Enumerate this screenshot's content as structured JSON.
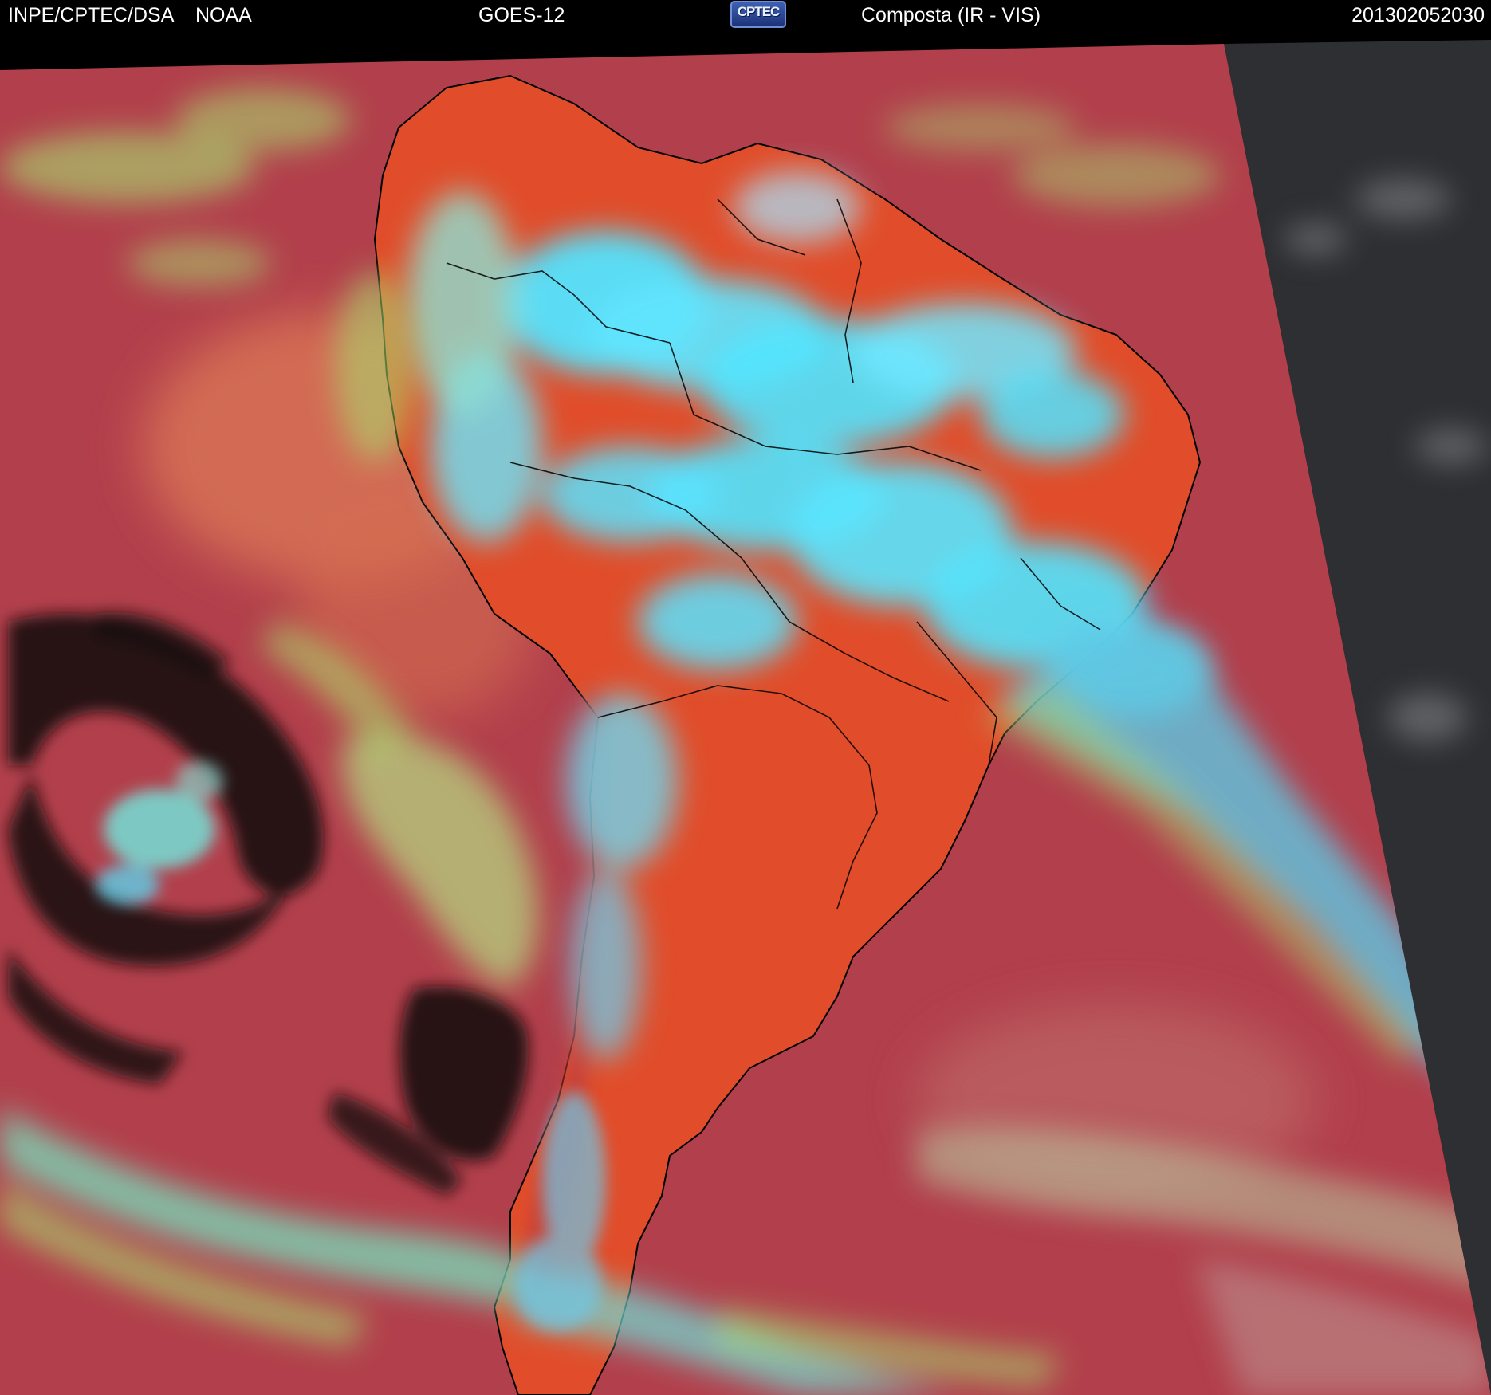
{
  "header": {
    "organization": "INPE/CPTEC/DSA",
    "agency": "NOAA",
    "satellite": "GOES-12",
    "logo_text": "CPTEC",
    "product": "Composta (IR - VIS)",
    "timestamp": "201302052030"
  },
  "colors": {
    "clear_ocean": "#b2404c",
    "warm_land": "#e14d2a",
    "high_cloud": "#52e4ff",
    "mid_cloud": "#a8e070",
    "low_cloud_black": "#161212",
    "night_side": "#2e2f33",
    "coastline": "#000000"
  }
}
